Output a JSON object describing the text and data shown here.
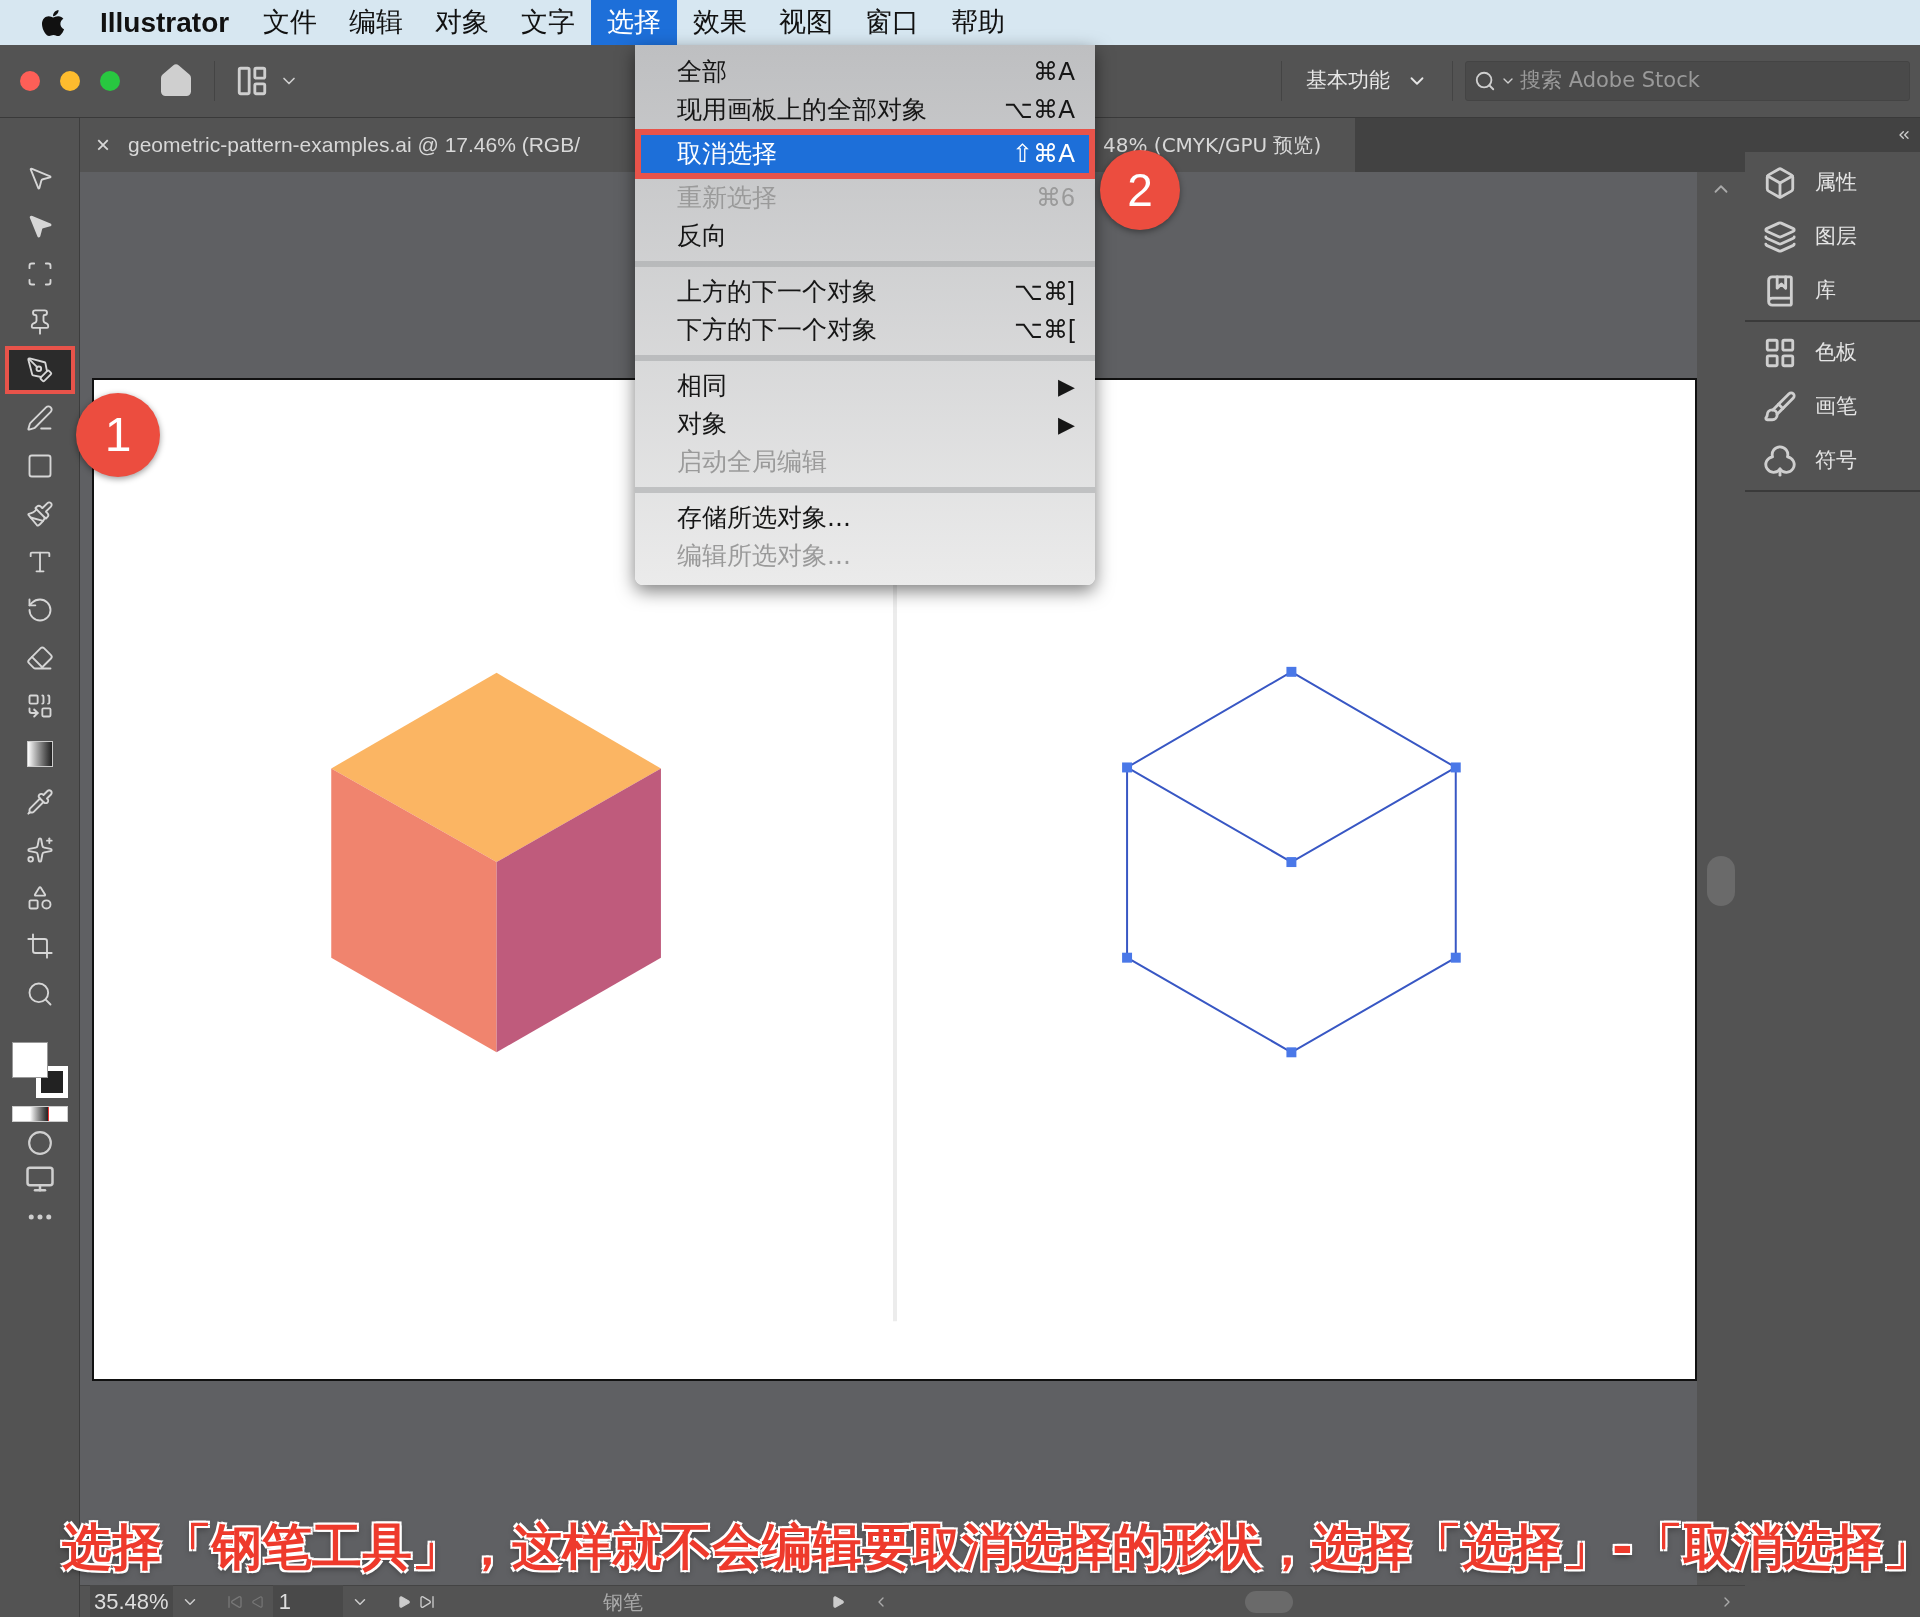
{
  "menubar": {
    "app": "Illustrator",
    "menus": [
      {
        "label": "文件",
        "selected": false
      },
      {
        "label": "编辑",
        "selected": false
      },
      {
        "label": "对象",
        "selected": false
      },
      {
        "label": "文字",
        "selected": false
      },
      {
        "label": "选择",
        "selected": true
      },
      {
        "label": "效果",
        "selected": false
      },
      {
        "label": "视图",
        "selected": false
      },
      {
        "label": "窗口",
        "selected": false
      },
      {
        "label": "帮助",
        "selected": false
      }
    ]
  },
  "toolbar": {
    "workspace": "基本功能",
    "search": {
      "placeholder": "搜索 Adobe Stock"
    }
  },
  "tabs": [
    {
      "label": "geometric-pattern-examples.ai @ 17.46% (RGB/",
      "close": "×"
    },
    {
      "label": "48% (CMYK/GPU 预览)"
    }
  ],
  "menu": [
    {
      "kind": "item",
      "label": "全部",
      "shortcut": "⌘A",
      "disabled": false,
      "selected": false
    },
    {
      "kind": "item",
      "label": "现用画板上的全部对象",
      "shortcut": "⌥⌘A",
      "disabled": false,
      "selected": false
    },
    {
      "kind": "item",
      "label": "取消选择",
      "shortcut": "⇧⌘A",
      "disabled": false,
      "selected": true
    },
    {
      "kind": "item",
      "label": "重新选择",
      "shortcut": "⌘6",
      "disabled": true,
      "selected": false
    },
    {
      "kind": "item",
      "label": "反向",
      "disabled": false,
      "selected": false
    },
    {
      "kind": "separator"
    },
    {
      "kind": "item",
      "label": "上方的下一个对象",
      "shortcut": "⌥⌘]",
      "disabled": false,
      "selected": false
    },
    {
      "kind": "item",
      "label": "下方的下一个对象",
      "shortcut": "⌥⌘[",
      "disabled": false,
      "selected": false
    },
    {
      "kind": "separator"
    },
    {
      "kind": "submenu",
      "label": "相同",
      "arrow": "▶",
      "disabled": false,
      "selected": false
    },
    {
      "kind": "submenu",
      "label": "对象",
      "arrow": "▶",
      "disabled": false,
      "selected": false
    },
    {
      "kind": "item",
      "label": "启动全局编辑",
      "disabled": true,
      "selected": false
    },
    {
      "kind": "separator"
    },
    {
      "kind": "item",
      "label": "存储所选对象...",
      "disabled": false,
      "selected": false
    },
    {
      "kind": "item",
      "label": "编辑所选对象...",
      "disabled": true,
      "selected": false
    }
  ],
  "tools": [
    {
      "kind": "selection",
      "selected": false
    },
    {
      "kind": "direct",
      "selected": false
    },
    {
      "kind": "artboard",
      "selected": false
    },
    {
      "kind": "pin",
      "selected": false
    },
    {
      "kind": "pen",
      "selected": true
    },
    {
      "kind": "curvature",
      "selected": false
    },
    {
      "kind": "rectangle",
      "selected": false
    },
    {
      "kind": "paintbrush",
      "selected": false
    },
    {
      "kind": "type",
      "selected": false
    },
    {
      "kind": "rotate",
      "selected": false
    },
    {
      "kind": "eraser",
      "selected": false
    },
    {
      "kind": "builder",
      "selected": false
    },
    {
      "kind": "gradient",
      "selected": false
    },
    {
      "kind": "eyedropper",
      "selected": false
    },
    {
      "kind": "blend",
      "selected": false
    },
    {
      "kind": "shapes",
      "selected": false
    },
    {
      "kind": "crop",
      "selected": false
    },
    {
      "kind": "zoom",
      "selected": false
    }
  ],
  "right_panel": [
    [
      {
        "kind": "properties",
        "label": "属性"
      },
      {
        "kind": "layers",
        "label": "图层"
      },
      {
        "kind": "libraries",
        "label": "库"
      }
    ],
    [
      {
        "kind": "swatches",
        "label": "色板"
      },
      {
        "kind": "brushes",
        "label": "画笔"
      },
      {
        "kind": "symbols",
        "label": "符号"
      }
    ]
  ],
  "callouts": [
    "1",
    "2"
  ],
  "caption": "选择「钢笔工具」，这样就不会编辑要取消选择的形状，选择「选择」-「取消选择」",
  "status_bar": {
    "zoom": "35.48%",
    "page": "1",
    "tool": "钢笔"
  }
}
